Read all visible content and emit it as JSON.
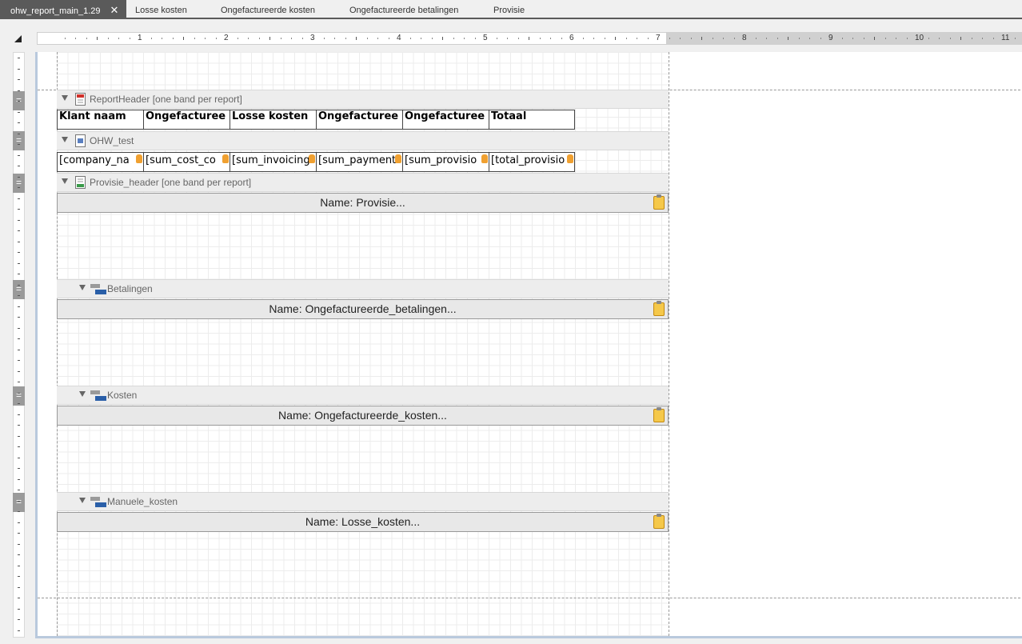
{
  "tabs": [
    {
      "label": "ohw_report_main_1.29",
      "active": true
    },
    {
      "label": "Losse kosten"
    },
    {
      "label": "Ongefactureerde kosten"
    },
    {
      "label": "Ongefactureerde betalingen"
    },
    {
      "label": "Provisie"
    }
  ],
  "tab_close_glyph": "✕",
  "ruler": {
    "numbers": [
      "1",
      "2",
      "3",
      "4",
      "5",
      "6",
      "7",
      "8",
      "9",
      "10",
      "11"
    ]
  },
  "bands": {
    "report_header": "ReportHeader [one band per report]",
    "detail": "OHW_test",
    "provisie_header": "Provisie_header [one band per report]",
    "betalingen": "Betalingen",
    "kosten": "Kosten",
    "manuele_kosten": "Manuele_kosten"
  },
  "header_cells": [
    "Klant naam",
    "Ongefacturee",
    "Losse kosten",
    "Ongefacturee",
    "Ongefacturee",
    "Totaal"
  ],
  "detail_cells": [
    "[company_na",
    "[sum_cost_co",
    "[sum_invoicing",
    "[sum_payment",
    "[sum_provisio",
    "[total_provisio"
  ],
  "subreports": {
    "provisie": "Name: Provisie...",
    "betalingen": "Name: Ongefactureerde_betalingen...",
    "kosten": "Name: Ongefactureerde_kosten...",
    "losse": "Name: Losse_kosten..."
  },
  "colors": {
    "accent": "#5a5a5a",
    "db_icon": "#f0a030",
    "clip_icon": "#f5c84a"
  }
}
